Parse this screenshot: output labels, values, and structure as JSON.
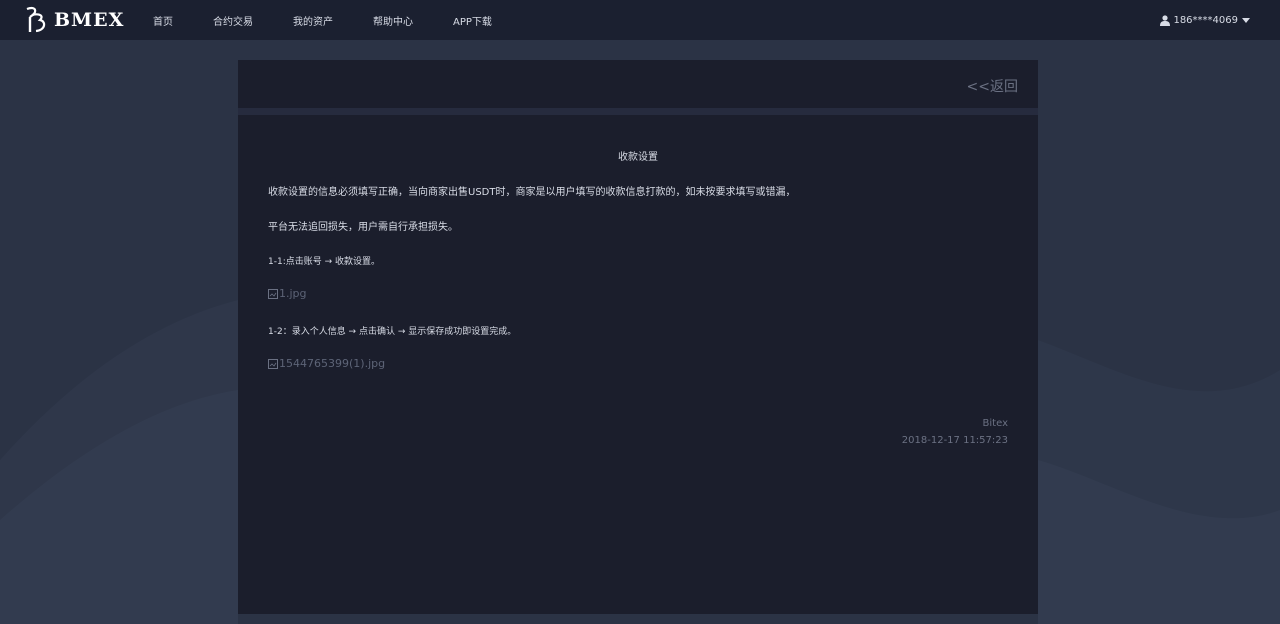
{
  "header": {
    "logo_text": "BMEX",
    "logo_icon": "bmex-logo-icon",
    "nav": [
      {
        "label": "首页"
      },
      {
        "label": "合约交易"
      },
      {
        "label": "我的资产"
      },
      {
        "label": "帮助中心"
      },
      {
        "label": "APP下载"
      }
    ],
    "user": {
      "icon": "user-icon",
      "label": "186****4069",
      "dropdown_icon": "caret-down-icon"
    }
  },
  "panel": {
    "back_label": "<<返回"
  },
  "article": {
    "title": "收款设置",
    "para1": "收款设置的信息必须填写正确，当向商家出售USDT时，商家是以用户填写的收款信息打款的，如未按要求填写或错漏，",
    "para2": "平台无法追回损失，用户需自行承担损失。",
    "step1": "1-1:点击账号  →  收款设置。",
    "image1_alt": "1.jpg",
    "step2": "1-2：录入个人信息  →  点击确认  →  显示保存成功即设置完成。",
    "image2_alt": "1544765399(1).jpg",
    "author": "Bitex",
    "date": "2018-12-17 11:57:23"
  },
  "colors": {
    "topbar": "#1b2030",
    "page_bg": "#2b3345",
    "panel_bg": "#1b1e2c",
    "text": "#d8dce6",
    "muted": "#6b7183"
  }
}
